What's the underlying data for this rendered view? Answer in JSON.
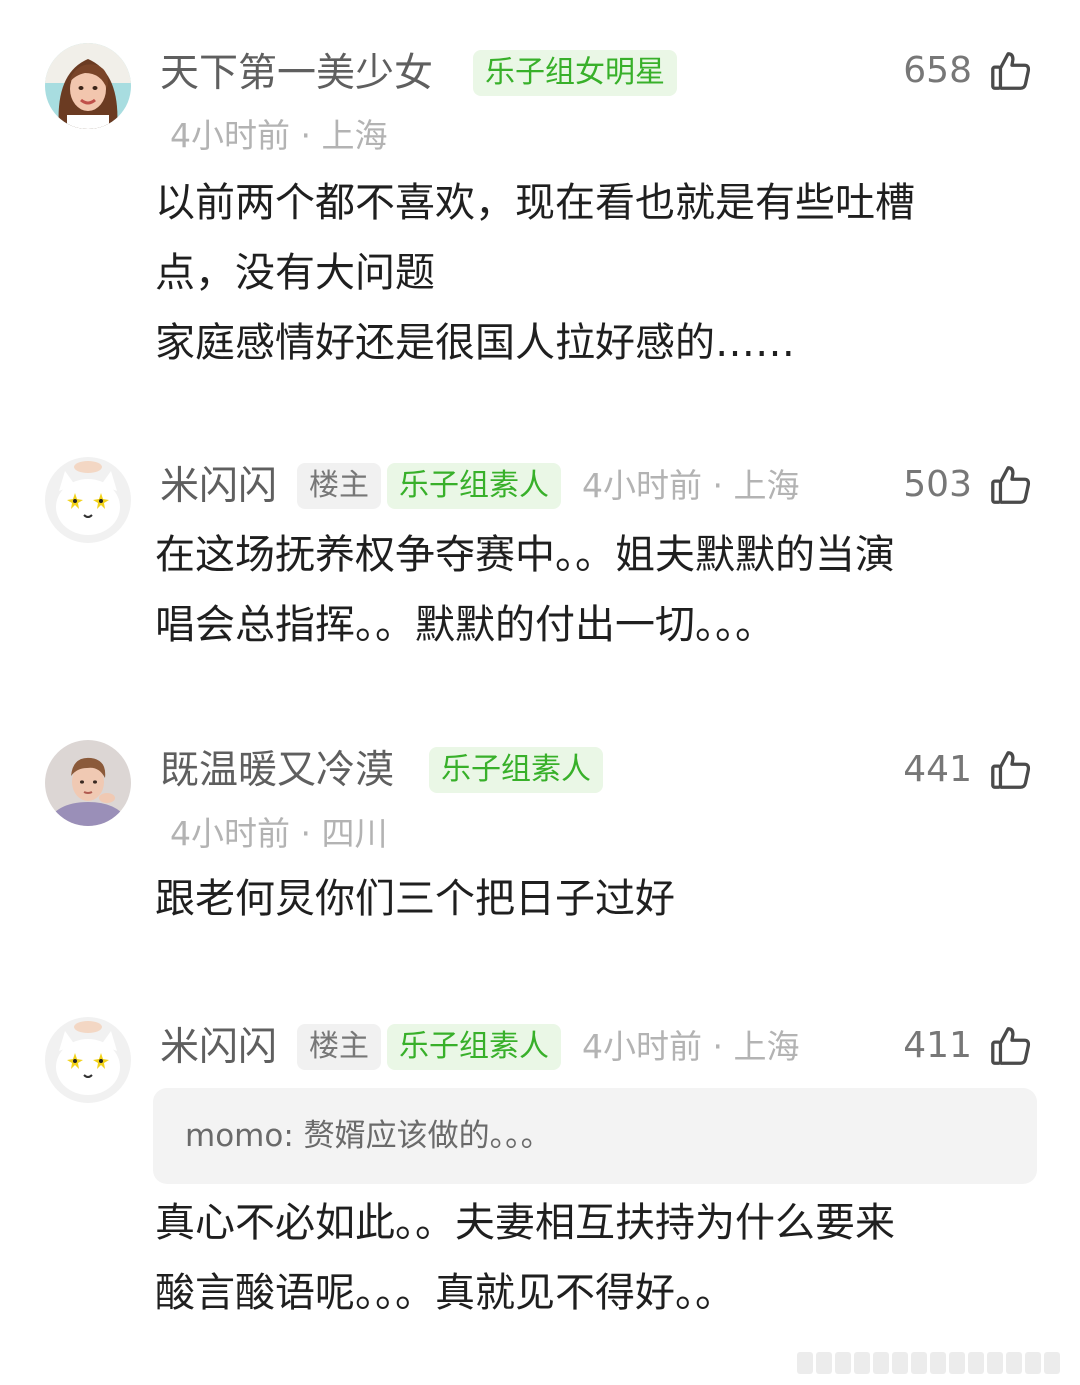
{
  "comments": [
    {
      "username": "天下第一美少女",
      "badges": [
        "乐子组女明星"
      ],
      "time": "4小时前",
      "location": "上海",
      "meta": "4小时前 · 上海",
      "likes": "658",
      "content": "以前两个都不喜欢，现在看也就是有些吐槽\n点，没有大问题\n家庭感情好还是很国人拉好感的……"
    },
    {
      "username": "米闪闪",
      "badges": [
        "楼主",
        "乐子组素人"
      ],
      "time": "4小时前",
      "location": "上海",
      "meta": "4小时前 · 上海",
      "likes": "503",
      "content": "在这场抚养权争夺赛中。。姐夫默默的当演\n唱会总指挥。。默默的付出一切。。。"
    },
    {
      "username": "既温暖又冷漠",
      "badges": [
        "乐子组素人"
      ],
      "time": "4小时前",
      "location": "四川",
      "meta": "4小时前 · 四川",
      "likes": "441",
      "content": "跟老何炅你们三个把日子过好"
    },
    {
      "username": "米闪闪",
      "badges": [
        "楼主",
        "乐子组素人"
      ],
      "time": "4小时前",
      "location": "上海",
      "meta": "4小时前 · 上海",
      "likes": "411",
      "quote": "momo: 赘婿应该做的。。。",
      "content": "真心不必如此。。夫妻相互扶持为什么要来\n酸言酸语呢。。。真就见不得好。。"
    }
  ],
  "icons": {
    "like": "thumbs-up-icon",
    "avatar_1": "girl-portrait-avatar",
    "avatar_2": "white-cat-avatar",
    "avatar_3": "boy-portrait-avatar",
    "avatar_4": "white-cat-avatar"
  },
  "colors": {
    "group_badge_bg": "#eaf7e6",
    "group_badge_text": "#38b02a",
    "owner_badge_bg": "#f1f1f1",
    "owner_badge_text": "#777777",
    "meta_text": "#b3b3b3",
    "username_text": "#5f5f5f",
    "quote_bg": "#f3f3f3"
  }
}
